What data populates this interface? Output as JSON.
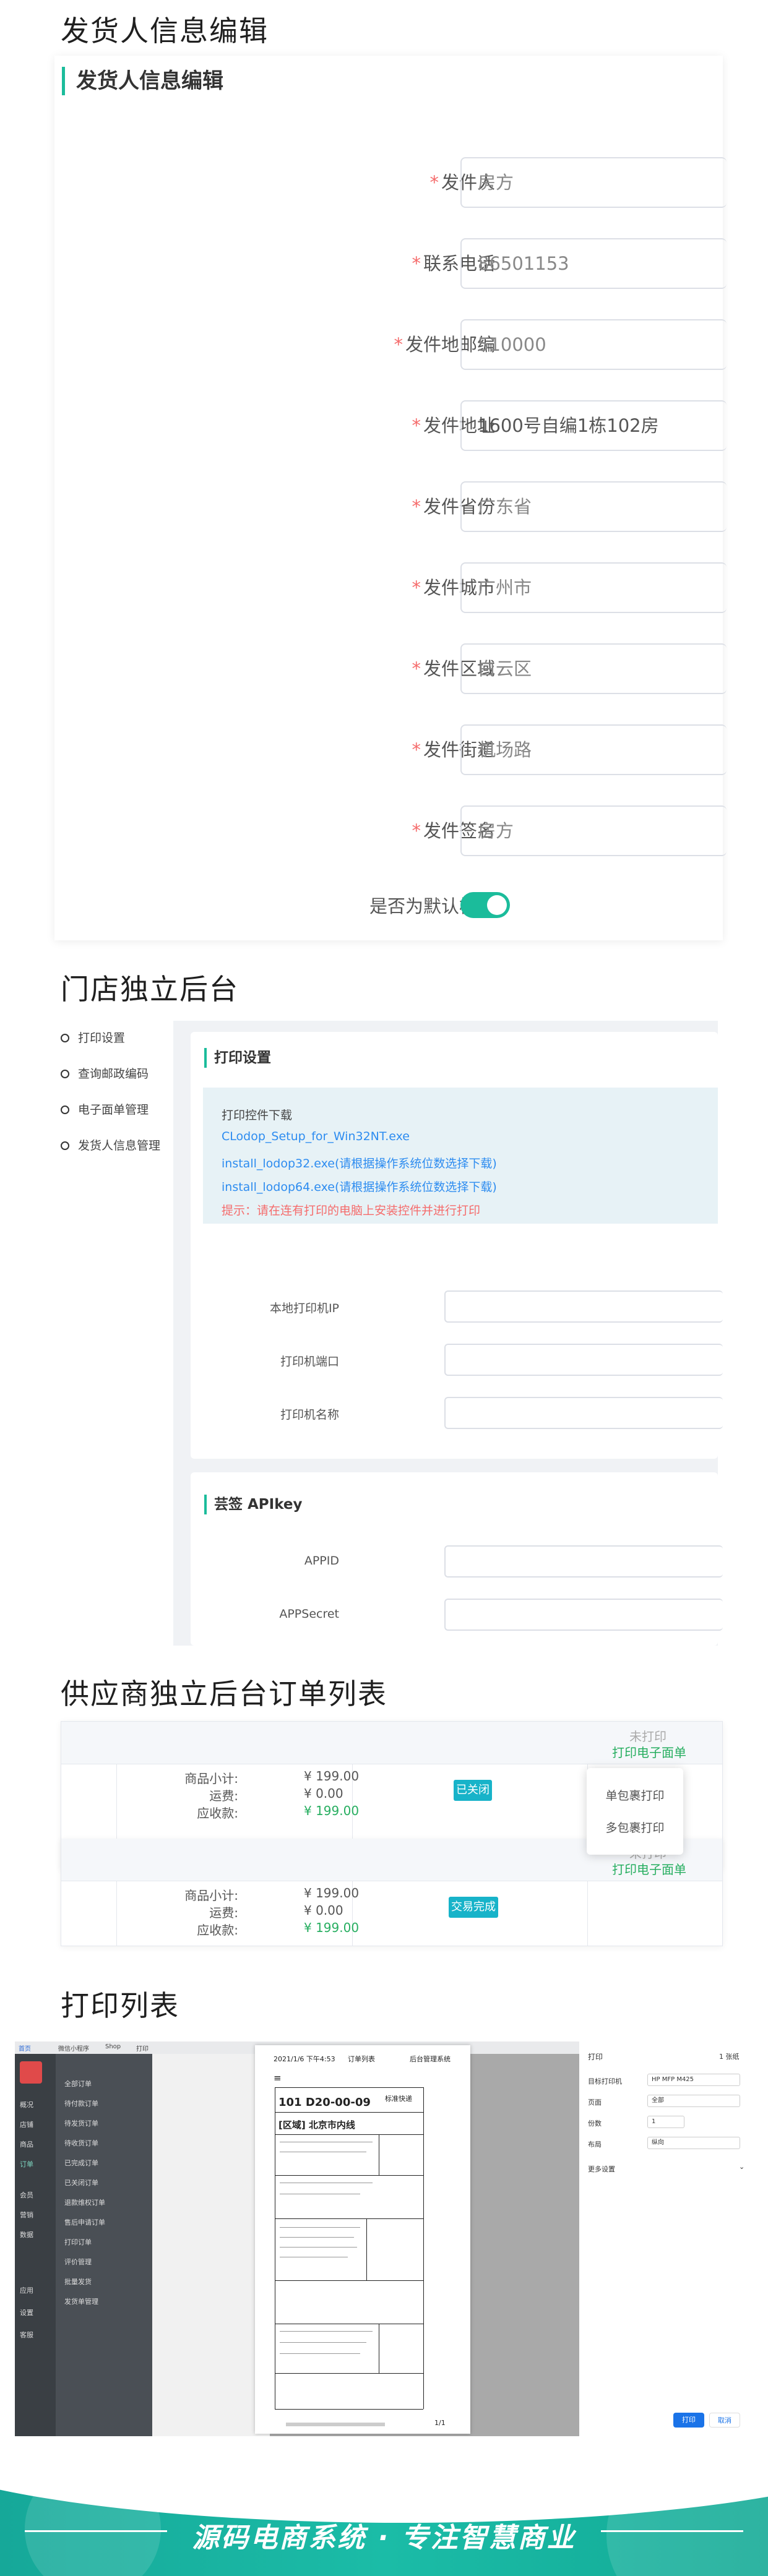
{
  "sections": {
    "sender_edit": "发货人信息编辑",
    "store_backend": "门店独立后台",
    "supplier_orders": "供应商独立后台订单列表",
    "print_list": "打印列表"
  },
  "sender_form": {
    "header": "发货人信息编辑",
    "required_mark": "*",
    "fields": [
      {
        "label": "发件人",
        "value": "房方"
      },
      {
        "label": "联系电话",
        "value": "86501153"
      },
      {
        "label": "发件地邮编",
        "value": "510000"
      },
      {
        "label": "发件地址",
        "value": "1600号自编1栋102房"
      },
      {
        "label": "发件省份",
        "value": "广东省"
      },
      {
        "label": "发件城市",
        "value": "广州市"
      },
      {
        "label": "发件区域",
        "value": "白云区"
      },
      {
        "label": "发件街道",
        "value": "机场路"
      },
      {
        "label": "发件签名",
        "value": "房方"
      }
    ],
    "default_label": "是否为默认模板",
    "default_on": true,
    "accent_color": "#1bbc9b"
  },
  "store_backend": {
    "menu": [
      "打印设置",
      "查询邮政编码",
      "电子面单管理",
      "发货人信息管理"
    ],
    "print_card": {
      "header": "打印设置",
      "download_title": "打印控件下载",
      "links": [
        "CLodop_Setup_for_Win32NT.exe",
        "install_lodop32.exe(请根据操作系统位数选择下载)",
        "install_lodop64.exe(请根据操作系统位数选择下载)"
      ],
      "hint": "提示：请在连有打印的电脑上安装控件并进行打印",
      "fields": [
        "本地打印机IP",
        "打印机端口",
        "打印机名称"
      ]
    },
    "api_card": {
      "header": "芸签 APIkey",
      "fields": [
        "APPID",
        "APPSecret"
      ]
    }
  },
  "orders": {
    "row1": {
      "status_top": "未打印",
      "status_link": "打印电子面单",
      "subtotal_label": "商品小计:",
      "subtotal": "¥ 199.00",
      "freight_label": "运费:",
      "freight": "¥ 0.00",
      "receivable_label": "应收款:",
      "receivable": "¥ 199.00",
      "badge": "已关闭"
    },
    "popup": [
      "单包裹打印",
      "多包裹打印"
    ],
    "row2": {
      "status_top": "未打印",
      "status_link": "打印电子面单",
      "subtotal_label": "商品小计:",
      "subtotal": "¥ 199.00",
      "freight_label": "运费:",
      "freight": "¥ 0.00",
      "receivable_label": "应收款:",
      "receivable": "¥ 199.00",
      "badge": "交易完成"
    },
    "green": "#27ae60",
    "teal": "#17b3c9"
  },
  "print_preview": {
    "top_tabs": [
      "首页",
      "微信小程序",
      "Shop",
      "打印"
    ],
    "left_nav": [
      "概况",
      "店铺",
      "商品",
      "订单",
      "会员",
      "营销",
      "数据",
      "应用",
      "设置",
      "客服"
    ],
    "order_menu": [
      "全部订单",
      "待付款订单",
      "待发货订单",
      "待收货订单",
      "已完成订单",
      "已关闭订单",
      "退款维权订单",
      "售后申请订单",
      "打印订单",
      "评价管理",
      "批量发货",
      "发货单管理"
    ],
    "paper": {
      "header_left": "2021/1/6 下午4:53",
      "header_mid": "订单列表",
      "header_right": "后台管理系统",
      "code": "101 D20-00-09",
      "area": "[区域] 北京市内线",
      "express": "标准快递",
      "footer": "1/1"
    },
    "dialog": {
      "title": "打印",
      "pages": "1 张纸",
      "printer_label": "目标打印机",
      "printer": "HP MFP M425",
      "pages_label": "页面",
      "pages_value": "全部",
      "copies_label": "份数",
      "copies_value": "1",
      "layout_label": "布局",
      "layout_value": "纵向",
      "more": "更多设置",
      "print_btn": "打印",
      "cancel_btn": "取消"
    }
  },
  "footer": {
    "slogan": "源码电商系统 · 专注智慧商业"
  }
}
